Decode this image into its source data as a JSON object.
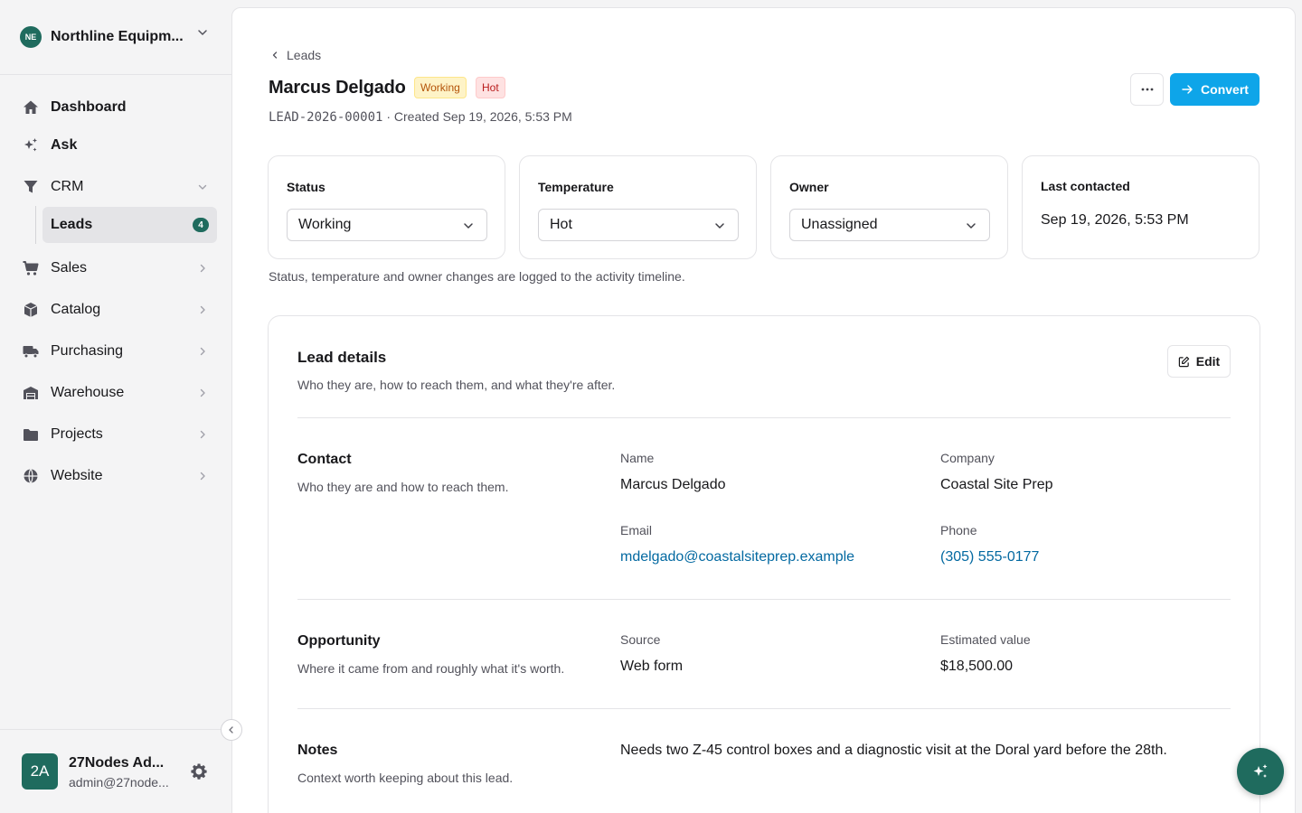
{
  "org": {
    "initials": "NE",
    "name": "Northline Equipm..."
  },
  "nav": {
    "dashboard": "Dashboard",
    "ask": "Ask",
    "crm": "CRM",
    "leads": "Leads",
    "leads_count": "4",
    "sales": "Sales",
    "catalog": "Catalog",
    "purchasing": "Purchasing",
    "warehouse": "Warehouse",
    "projects": "Projects",
    "website": "Website"
  },
  "user": {
    "initials": "2A",
    "name": "27Nodes Ad...",
    "email": "admin@27node..."
  },
  "breadcrumb": "Leads",
  "lead": {
    "name": "Marcus Delgado",
    "status_badge": "Working",
    "temperature_badge": "Hot",
    "id": "LEAD‑2026‑00001",
    "created": " · Created Sep 19, 2026, 5:53 PM"
  },
  "actions": {
    "convert": "Convert"
  },
  "cards": {
    "status": {
      "label": "Status",
      "value": "Working"
    },
    "temperature": {
      "label": "Temperature",
      "value": "Hot"
    },
    "owner": {
      "label": "Owner",
      "value": "Unassigned"
    },
    "last_contacted": {
      "label": "Last contacted",
      "value": "Sep 19, 2026, 5:53 PM"
    }
  },
  "hint": "Status, temperature and owner changes are logged to the activity timeline.",
  "details": {
    "title": "Lead details",
    "subtitle": "Who they are, how to reach them, and what they're after.",
    "edit": "Edit",
    "contact": {
      "title": "Contact",
      "subtitle": "Who they are and how to reach them.",
      "name_label": "Name",
      "name": "Marcus Delgado",
      "company_label": "Company",
      "company": "Coastal Site Prep",
      "email_label": "Email",
      "email": "mdelgado@coastalsiteprep.example",
      "phone_label": "Phone",
      "phone": "(305) 555-0177"
    },
    "opportunity": {
      "title": "Opportunity",
      "subtitle": "Where it came from and roughly what it's worth.",
      "source_label": "Source",
      "source": "Web form",
      "value_label": "Estimated value",
      "value": "$18,500.00"
    },
    "notes": {
      "title": "Notes",
      "subtitle": "Context worth keeping about this lead.",
      "text": "Needs two Z-45 control boxes and a diagnostic visit at the Doral yard before the 28th."
    }
  },
  "colors": {
    "brand": "#1f6b5e",
    "primary": "#0ea5e9",
    "link": "#0369a1"
  }
}
